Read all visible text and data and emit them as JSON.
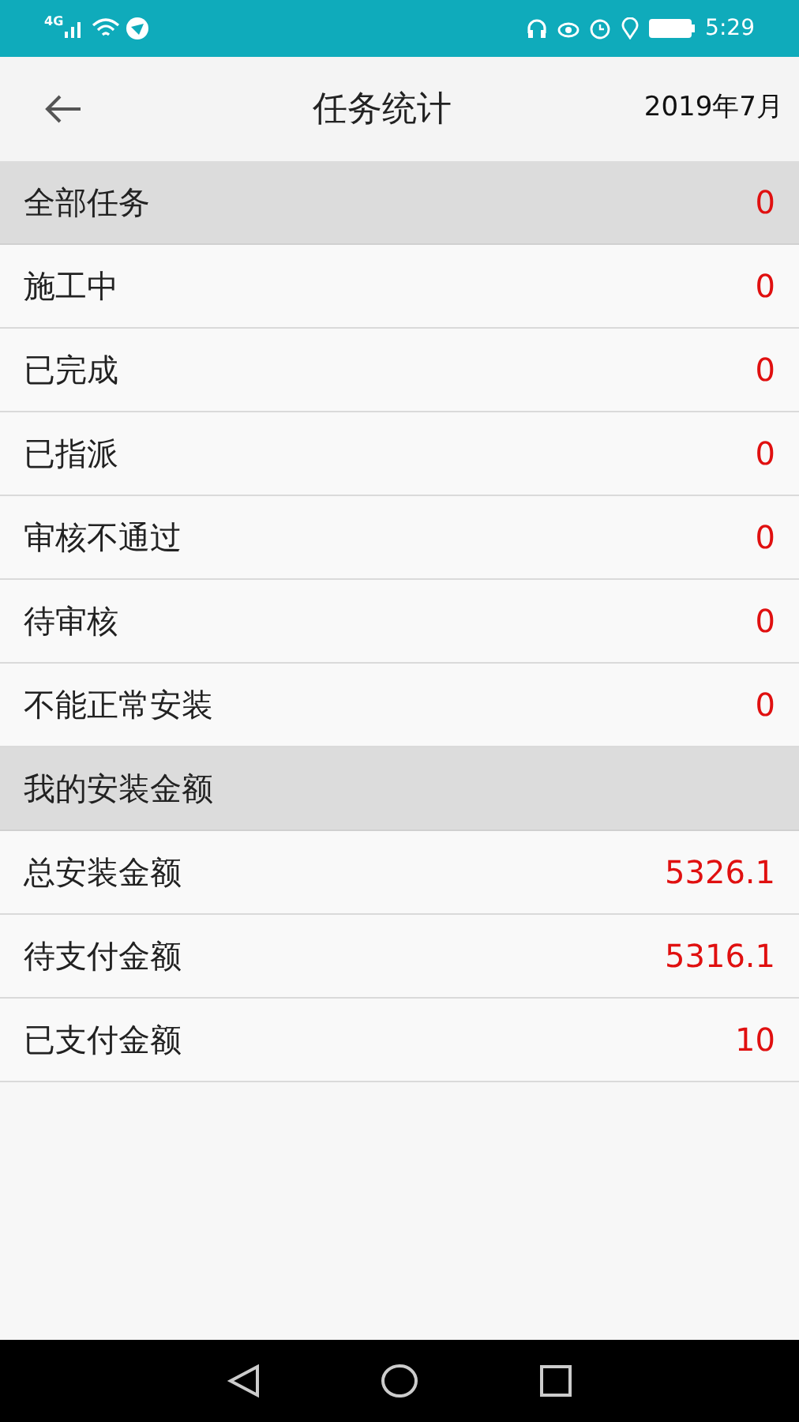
{
  "status_bar": {
    "network": "4G",
    "time": "5:29"
  },
  "header": {
    "title": "任务统计",
    "date": "2019年7月"
  },
  "rows": [
    {
      "kind": "header",
      "label": "全部任务",
      "value": "0"
    },
    {
      "kind": "item",
      "label": "施工中",
      "value": "0"
    },
    {
      "kind": "item",
      "label": "已完成",
      "value": "0"
    },
    {
      "kind": "item",
      "label": "已指派",
      "value": "0"
    },
    {
      "kind": "item",
      "label": "审核不通过",
      "value": "0"
    },
    {
      "kind": "item",
      "label": "待审核",
      "value": "0"
    },
    {
      "kind": "item",
      "label": "不能正常安装",
      "value": "0"
    },
    {
      "kind": "header",
      "label": "我的安装金额"
    },
    {
      "kind": "item",
      "label": "总安装金额",
      "value": "5326.1"
    },
    {
      "kind": "item",
      "label": "待支付金额",
      "value": "5316.1"
    },
    {
      "kind": "item",
      "label": "已支付金额",
      "value": "10"
    }
  ]
}
